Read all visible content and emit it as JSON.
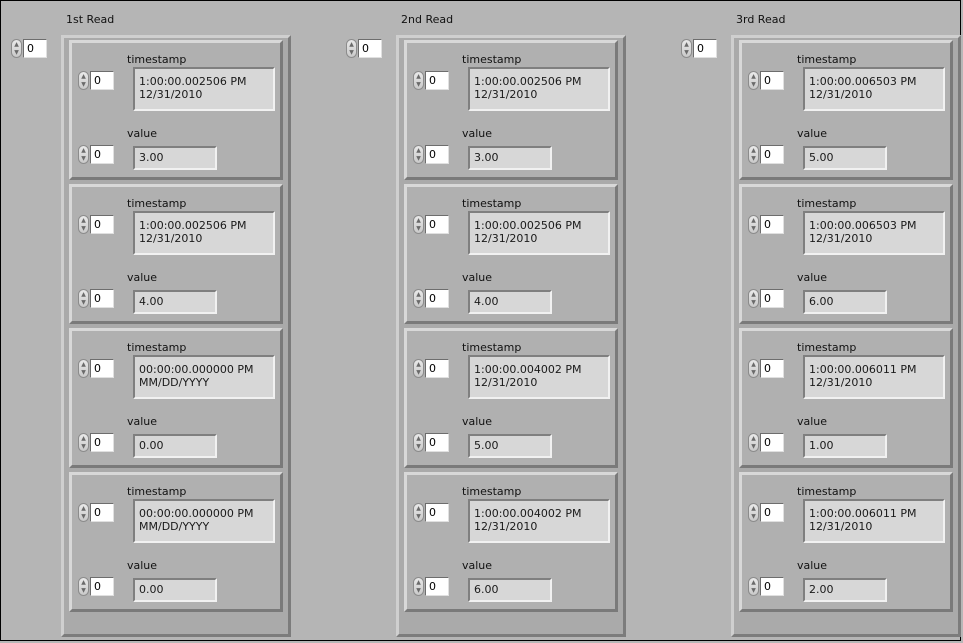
{
  "columns": [
    {
      "title": "1st Read",
      "outer_index": "0",
      "clusters": [
        {
          "index": "0",
          "timestamp_label": "timestamp",
          "timestamp_line1": "1:00:00.002506 PM",
          "timestamp_line2": "12/31/2010",
          "value_index": "0",
          "value_label": "value",
          "value": "3.00"
        },
        {
          "index": "0",
          "timestamp_label": "timestamp",
          "timestamp_line1": "1:00:00.002506 PM",
          "timestamp_line2": "12/31/2010",
          "value_index": "0",
          "value_label": "value",
          "value": "4.00"
        },
        {
          "index": "0",
          "timestamp_label": "timestamp",
          "timestamp_line1": "00:00:00.000000 PM",
          "timestamp_line2": "MM/DD/YYYY",
          "value_index": "0",
          "value_label": "value",
          "value": "0.00"
        },
        {
          "index": "0",
          "timestamp_label": "timestamp",
          "timestamp_line1": "00:00:00.000000 PM",
          "timestamp_line2": "MM/DD/YYYY",
          "value_index": "0",
          "value_label": "value",
          "value": "0.00"
        }
      ]
    },
    {
      "title": "2nd Read",
      "outer_index": "0",
      "clusters": [
        {
          "index": "0",
          "timestamp_label": "timestamp",
          "timestamp_line1": "1:00:00.002506 PM",
          "timestamp_line2": "12/31/2010",
          "value_index": "0",
          "value_label": "value",
          "value": "3.00"
        },
        {
          "index": "0",
          "timestamp_label": "timestamp",
          "timestamp_line1": "1:00:00.002506 PM",
          "timestamp_line2": "12/31/2010",
          "value_index": "0",
          "value_label": "value",
          "value": "4.00"
        },
        {
          "index": "0",
          "timestamp_label": "timestamp",
          "timestamp_line1": "1:00:00.004002 PM",
          "timestamp_line2": "12/31/2010",
          "value_index": "0",
          "value_label": "value",
          "value": "5.00"
        },
        {
          "index": "0",
          "timestamp_label": "timestamp",
          "timestamp_line1": "1:00:00.004002 PM",
          "timestamp_line2": "12/31/2010",
          "value_index": "0",
          "value_label": "value",
          "value": "6.00"
        }
      ]
    },
    {
      "title": "3rd Read",
      "outer_index": "0",
      "clusters": [
        {
          "index": "0",
          "timestamp_label": "timestamp",
          "timestamp_line1": "1:00:00.006503 PM",
          "timestamp_line2": "12/31/2010",
          "value_index": "0",
          "value_label": "value",
          "value": "5.00"
        },
        {
          "index": "0",
          "timestamp_label": "timestamp",
          "timestamp_line1": "1:00:00.006503 PM",
          "timestamp_line2": "12/31/2010",
          "value_index": "0",
          "value_label": "value",
          "value": "6.00"
        },
        {
          "index": "0",
          "timestamp_label": "timestamp",
          "timestamp_line1": "1:00:00.006011 PM",
          "timestamp_line2": "12/31/2010",
          "value_index": "0",
          "value_label": "value",
          "value": "1.00"
        },
        {
          "index": "0",
          "timestamp_label": "timestamp",
          "timestamp_line1": "1:00:00.006011 PM",
          "timestamp_line2": "12/31/2010",
          "value_index": "0",
          "value_label": "value",
          "value": "2.00"
        }
      ]
    }
  ]
}
